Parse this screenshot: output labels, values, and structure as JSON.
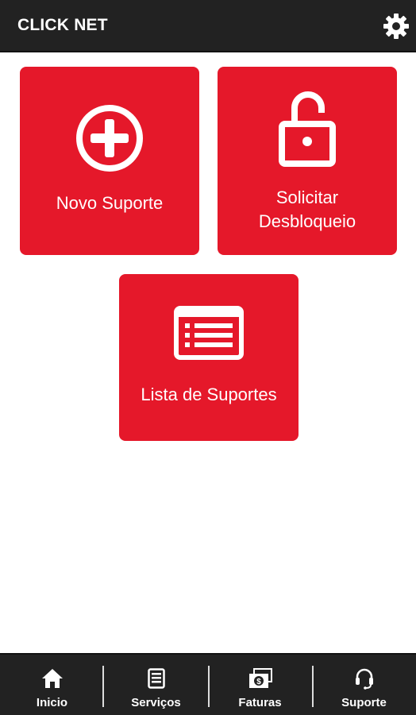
{
  "app_bar": {
    "title": "CLICK NET",
    "settings_icon": "gear-icon"
  },
  "tiles": [
    {
      "label": "Novo Suporte",
      "icon": "plus-circle-icon"
    },
    {
      "label_line1": "Solicitar",
      "label_line2": "Desbloqueio",
      "icon": "unlock-icon"
    },
    {
      "label": "Lista de Suportes",
      "icon": "list-icon"
    }
  ],
  "bottom_nav": {
    "items": [
      {
        "label": "Inicio",
        "icon": "home-icon"
      },
      {
        "label": "Serviços",
        "icon": "document-icon"
      },
      {
        "label": "Faturas",
        "icon": "money-icon"
      },
      {
        "label": "Suporte",
        "icon": "headset-icon"
      }
    ]
  },
  "colors": {
    "accent": "#e5182a",
    "bar": "#222222",
    "text_on_accent": "#ffffff"
  }
}
